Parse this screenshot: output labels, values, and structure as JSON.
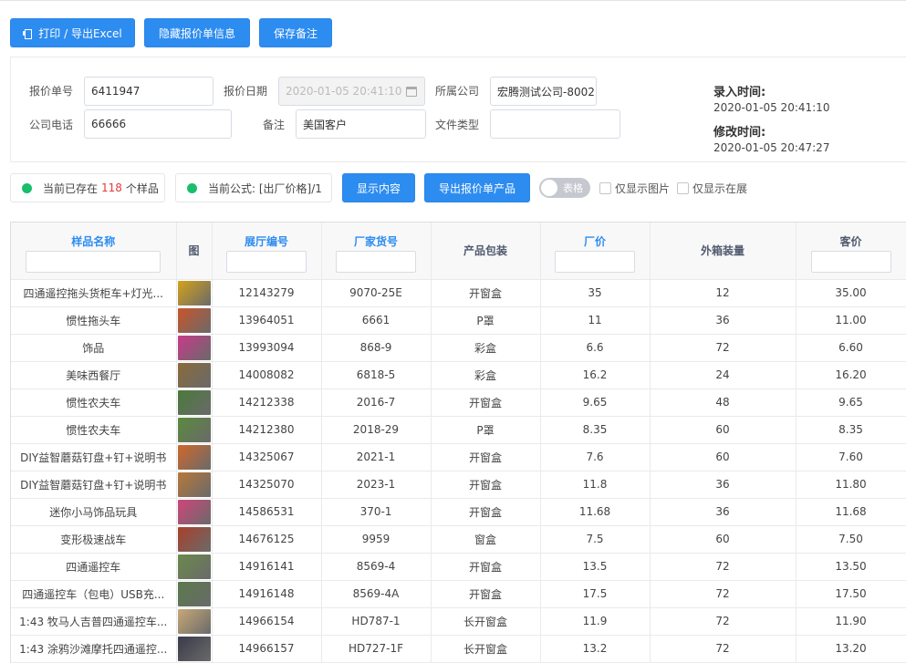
{
  "toolbar": {
    "print_export_label": "打印 / 导出Excel",
    "hide_quote_info_label": "隐藏报价单信息",
    "save_note_label": "保存备注"
  },
  "form": {
    "quote_no": {
      "label": "报价单号",
      "value": "6411947"
    },
    "quote_date": {
      "label": "报价日期",
      "value": "2020-01-05 20:41:10"
    },
    "company": {
      "label": "所属公司",
      "value": "宏腾测试公司-8002"
    },
    "phone": {
      "label": "公司电话",
      "value": "66666"
    },
    "note": {
      "label": "备注",
      "value": "美国客户"
    },
    "file_type": {
      "label": "文件类型",
      "value": ""
    }
  },
  "meta": {
    "created_label": "录入时间:",
    "created_value": "2020-01-05 20:41:10",
    "modified_label": "修改时间:",
    "modified_value": "2020-01-05 20:47:27"
  },
  "status": {
    "count_prefix": "当前已存在",
    "count": "118",
    "count_suffix": "个样品",
    "formula": "当前公式: [出厂价格]/1"
  },
  "actions": {
    "show_content_label": "显示内容",
    "export_products_label": "导出报价单产品",
    "view_toggle_label": "表格",
    "only_images_label": "仅显示图片",
    "only_showroom_label": "仅显示在展"
  },
  "table": {
    "headers": [
      "样品名称",
      "图",
      "展厅编号",
      "厂家货号",
      "产品包装",
      "厂价",
      "外箱装量",
      "客价"
    ],
    "rows": [
      {
        "name": "四通遥控拖头货柜车+灯光...",
        "hall_no": "12143279",
        "factory_no": "9070-25E",
        "package": "开窗盒",
        "factory_price": "35",
        "outer_qty": "12",
        "client_price": "35.00",
        "thumb": "#d4a21a"
      },
      {
        "name": "惯性拖头车",
        "hall_no": "13964051",
        "factory_no": "6661",
        "package": "P罩",
        "factory_price": "11",
        "outer_qty": "36",
        "client_price": "11.00",
        "thumb": "#c9552a"
      },
      {
        "name": "饰品",
        "hall_no": "13993094",
        "factory_no": "868-9",
        "package": "彩盒",
        "factory_price": "6.6",
        "outer_qty": "72",
        "client_price": "6.60",
        "thumb": "#c83a8a"
      },
      {
        "name": "美味西餐厅",
        "hall_no": "14008082",
        "factory_no": "6818-5",
        "package": "彩盒",
        "factory_price": "16.2",
        "outer_qty": "24",
        "client_price": "16.20",
        "thumb": "#8a6a3a"
      },
      {
        "name": "惯性农夫车",
        "hall_no": "14212338",
        "factory_no": "2016-7",
        "package": "开窗盒",
        "factory_price": "9.65",
        "outer_qty": "48",
        "client_price": "9.65",
        "thumb": "#4a7a3a"
      },
      {
        "name": "惯性农夫车",
        "hall_no": "14212380",
        "factory_no": "2018-29",
        "package": "P罩",
        "factory_price": "8.35",
        "outer_qty": "60",
        "client_price": "8.35",
        "thumb": "#5a8a3c"
      },
      {
        "name": "DIY益智蘑菇钉盘+钉+说明书",
        "hall_no": "14325067",
        "factory_no": "2021-1",
        "package": "开窗盒",
        "factory_price": "7.6",
        "outer_qty": "60",
        "client_price": "7.60",
        "thumb": "#d0682a"
      },
      {
        "name": "DIY益智蘑菇钉盘+钉+说明书",
        "hall_no": "14325070",
        "factory_no": "2023-1",
        "package": "开窗盒",
        "factory_price": "11.8",
        "outer_qty": "36",
        "client_price": "11.80",
        "thumb": "#b8783a"
      },
      {
        "name": "迷你小马饰品玩具",
        "hall_no": "14586531",
        "factory_no": "370-1",
        "package": "开窗盒",
        "factory_price": "11.68",
        "outer_qty": "36",
        "client_price": "11.68",
        "thumb": "#d0457a"
      },
      {
        "name": "变形极速战车",
        "hall_no": "14676125",
        "factory_no": "9959",
        "package": "窗盒",
        "factory_price": "7.5",
        "outer_qty": "60",
        "client_price": "7.50",
        "thumb": "#a8402a"
      },
      {
        "name": "四通遥控车",
        "hall_no": "14916141",
        "factory_no": "8569-4",
        "package": "开窗盒",
        "factory_price": "13.5",
        "outer_qty": "72",
        "client_price": "13.50",
        "thumb": "#6a8a4a"
      },
      {
        "name": "四通遥控车（包电）USB充...",
        "hall_no": "14916148",
        "factory_no": "8569-4A",
        "package": "开窗盒",
        "factory_price": "17.5",
        "outer_qty": "72",
        "client_price": "17.50",
        "thumb": "#5a7a4a"
      },
      {
        "name": "1:43 牧马人吉普四通遥控车...",
        "hall_no": "14966154",
        "factory_no": "HD787-1",
        "package": "长开窗盒",
        "factory_price": "11.9",
        "outer_qty": "72",
        "client_price": "11.90",
        "thumb": "#c8a878"
      },
      {
        "name": "1:43 涂鸦沙滩摩托四通遥控...",
        "hall_no": "14966157",
        "factory_no": "HD727-1F",
        "package": "长开窗盒",
        "factory_price": "13.2",
        "outer_qty": "72",
        "client_price": "13.20",
        "thumb": "#3a3a4a"
      }
    ]
  }
}
